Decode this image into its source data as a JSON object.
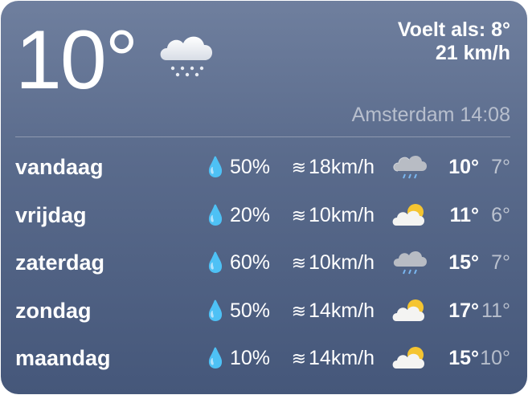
{
  "current": {
    "temperature": "10°",
    "icon": "rain-cloud-icon",
    "feels_like": "Voelt als: 8°",
    "wind": "21 km/h",
    "location_time": "Amsterdam 14:08"
  },
  "forecast": [
    {
      "day": "vandaag",
      "precip": "50%",
      "wind": "18km/h",
      "icon": "rain-cloud-icon",
      "high": "10°",
      "low": "7°"
    },
    {
      "day": "vrijdag",
      "precip": "20%",
      "wind": "10km/h",
      "icon": "partly-sunny-icon",
      "high": "11°",
      "low": "6°"
    },
    {
      "day": "zaterdag",
      "precip": "60%",
      "wind": "10km/h",
      "icon": "rain-cloud-icon",
      "high": "15°",
      "low": "7°"
    },
    {
      "day": "zondag",
      "precip": "50%",
      "wind": "14km/h",
      "icon": "partly-sunny-icon",
      "high": "17°",
      "low": "11°"
    },
    {
      "day": "maandag",
      "precip": "10%",
      "wind": "14km/h",
      "icon": "partly-sunny-icon",
      "high": "15°",
      "low": "10°"
    }
  ],
  "colors": {
    "background_top": "#6f7f9e",
    "background_bottom": "#45577a",
    "text": "#ffffff",
    "sun": "#f5c531"
  }
}
